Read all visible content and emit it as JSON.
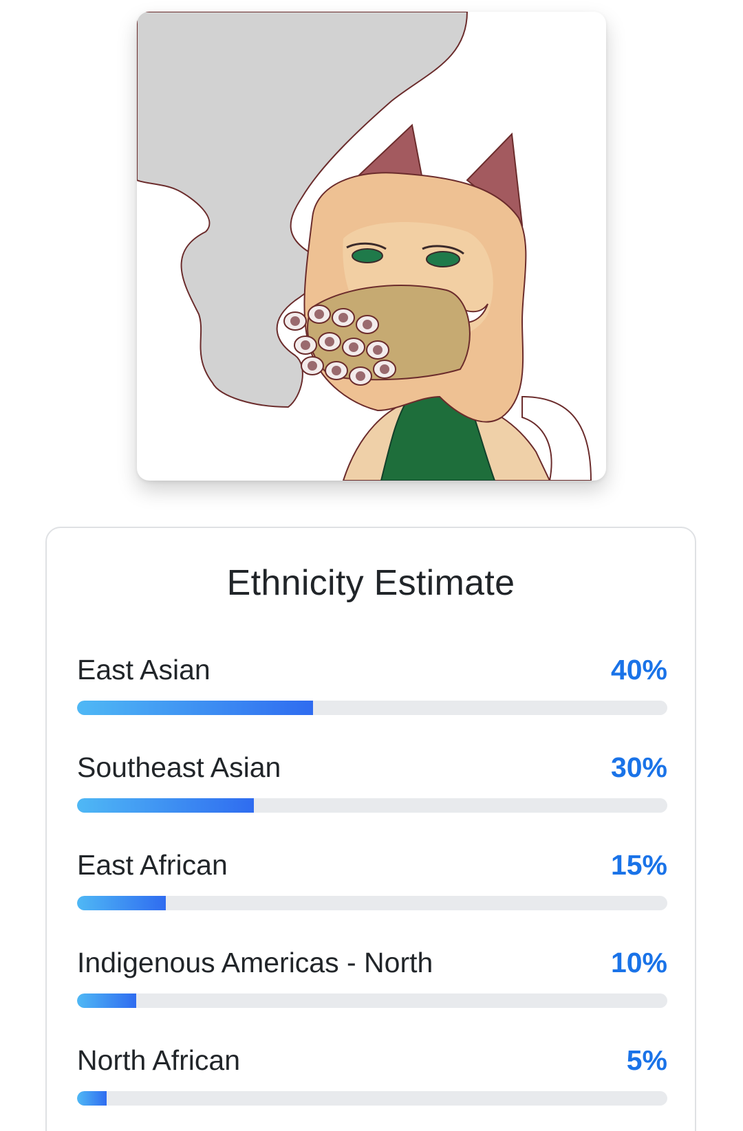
{
  "photo": {
    "alt_description": ""
  },
  "estimate": {
    "title": "Ethnicity Estimate",
    "accent_color": "#1a73e8",
    "bar_gradient": [
      "#4fb8f5",
      "#2f6cf0"
    ],
    "track_color": "#e8eaed",
    "items": [
      {
        "label": "East Asian",
        "value_text": "40%",
        "percent": 40
      },
      {
        "label": "Southeast Asian",
        "value_text": "30%",
        "percent": 30
      },
      {
        "label": "East African",
        "value_text": "15%",
        "percent": 15
      },
      {
        "label": "Indigenous Americas - North",
        "value_text": "10%",
        "percent": 10
      },
      {
        "label": "North African",
        "value_text": "5%",
        "percent": 5
      }
    ]
  }
}
